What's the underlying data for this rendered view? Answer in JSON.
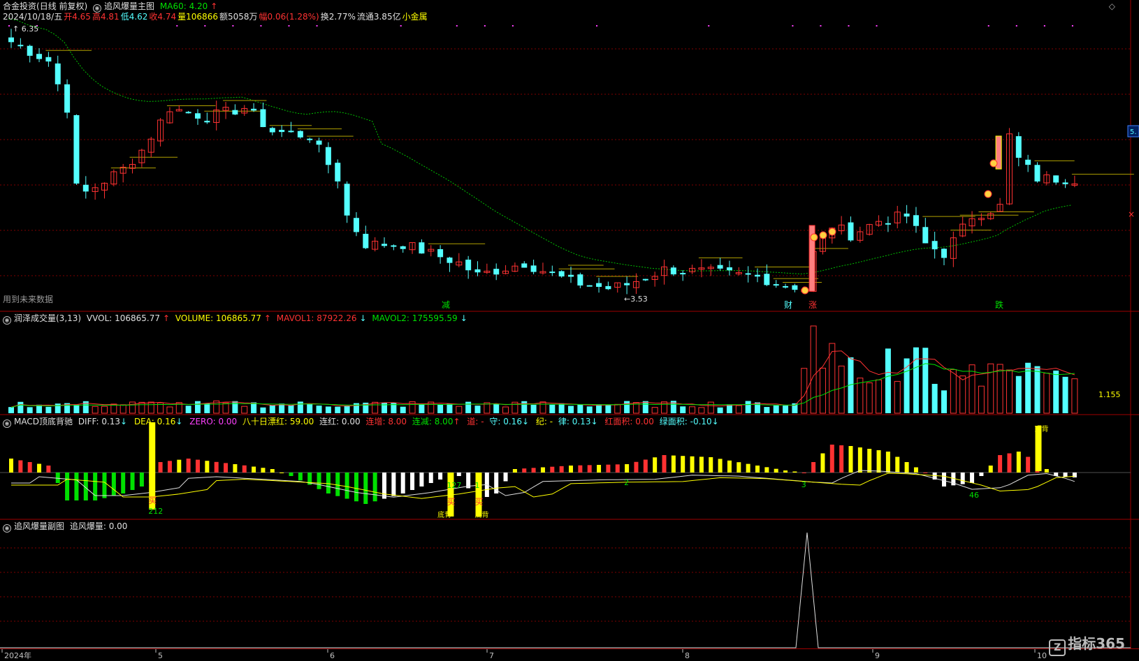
{
  "header": {
    "stock_name": "合金投资",
    "mode": "(日线 前复权)",
    "indicator": "追风爆量主图",
    "ma_label": "MA60: 4.20",
    "date": "2024/10/18/五",
    "open": "开4.65",
    "high": "高4.81",
    "low": "低4.62",
    "close": "收4.74",
    "volume": "量106866",
    "amount": "额5058万",
    "change": "幅0.06(1.28%)",
    "turnover": "换2.77%",
    "float": "流通3.85亿",
    "sector": "小金属"
  },
  "main_labels": {
    "high_mark": "6.35",
    "low_mark": "3.53",
    "future_note": "用到未来数据",
    "jian": "减",
    "cai": "财",
    "zhang": "涨",
    "die": "跌",
    "right_axis": "5."
  },
  "vol_header": {
    "name": "润泽成交量(3,13)",
    "vvol": "VVOL: 106865.77",
    "volume": "VOLUME: 106865.77",
    "mavol1": "MAVOL1: 87922.26",
    "mavol2": "MAVOL2: 175595.59",
    "right_val": "1.155"
  },
  "macd_header": {
    "name": "MACD顶底背驰",
    "diff": "DIFF: 0.13",
    "dea": "DEA: 0.16",
    "zero": "ZERO: 0.00",
    "eighty": "八十日漂红: 59.00",
    "lianhong": "连红: 0.00",
    "lianzeng": "连增: 8.00",
    "lianjian": "连减: 8.00",
    "dao": "道: -",
    "shou": "守: 0.16",
    "ji": "纪: -",
    "lv": "律: 0.13",
    "red_area": "红面积: 0.00",
    "green_area": "绿面积: -0.10"
  },
  "macd_labels": {
    "buy": "买",
    "n212": "212",
    "n127": "127",
    "n1": "1",
    "n2": "2",
    "n3": "3",
    "n46": "46",
    "bottom_div": "底背",
    "bottom_div2": "底背",
    "top_div": "顶背"
  },
  "sub_header": {
    "name": "追风爆量副图",
    "value": "追风爆量: 0.00"
  },
  "xaxis": {
    "labels": [
      "2024年",
      "5",
      "6",
      "7",
      "8",
      "9",
      "10"
    ]
  },
  "logo": {
    "text": "指标365",
    "mark": "Z"
  },
  "colors": {
    "up": "#ff3232",
    "down": "#54ffff",
    "ma": "#00c000",
    "yellow": "#ffff00",
    "grid": "#800000"
  },
  "chart_data": {
    "type": "candlestick",
    "x": [
      "2024-04",
      "2024-05",
      "2024-06",
      "2024-07",
      "2024-08",
      "2024-09",
      "2024-10-18"
    ],
    "last_bar": {
      "date": "2024/10/18",
      "open": 4.65,
      "high": 4.81,
      "low": 4.62,
      "close": 4.74,
      "volume": 106866
    },
    "series": [
      {
        "name": "MA60",
        "last": 4.2
      }
    ],
    "annotations": [
      {
        "label": "6.35",
        "kind": "high"
      },
      {
        "label": "3.53",
        "kind": "low"
      }
    ],
    "volume_series": [
      {
        "name": "VOLUME",
        "last": 106865.77
      },
      {
        "name": "MAVOL1",
        "last": 87922.26
      },
      {
        "name": "MAVOL2",
        "last": 175595.59
      }
    ],
    "macd_series": [
      {
        "name": "DIFF",
        "last": 0.13
      },
      {
        "name": "DEA",
        "last": 0.16
      }
    ]
  }
}
